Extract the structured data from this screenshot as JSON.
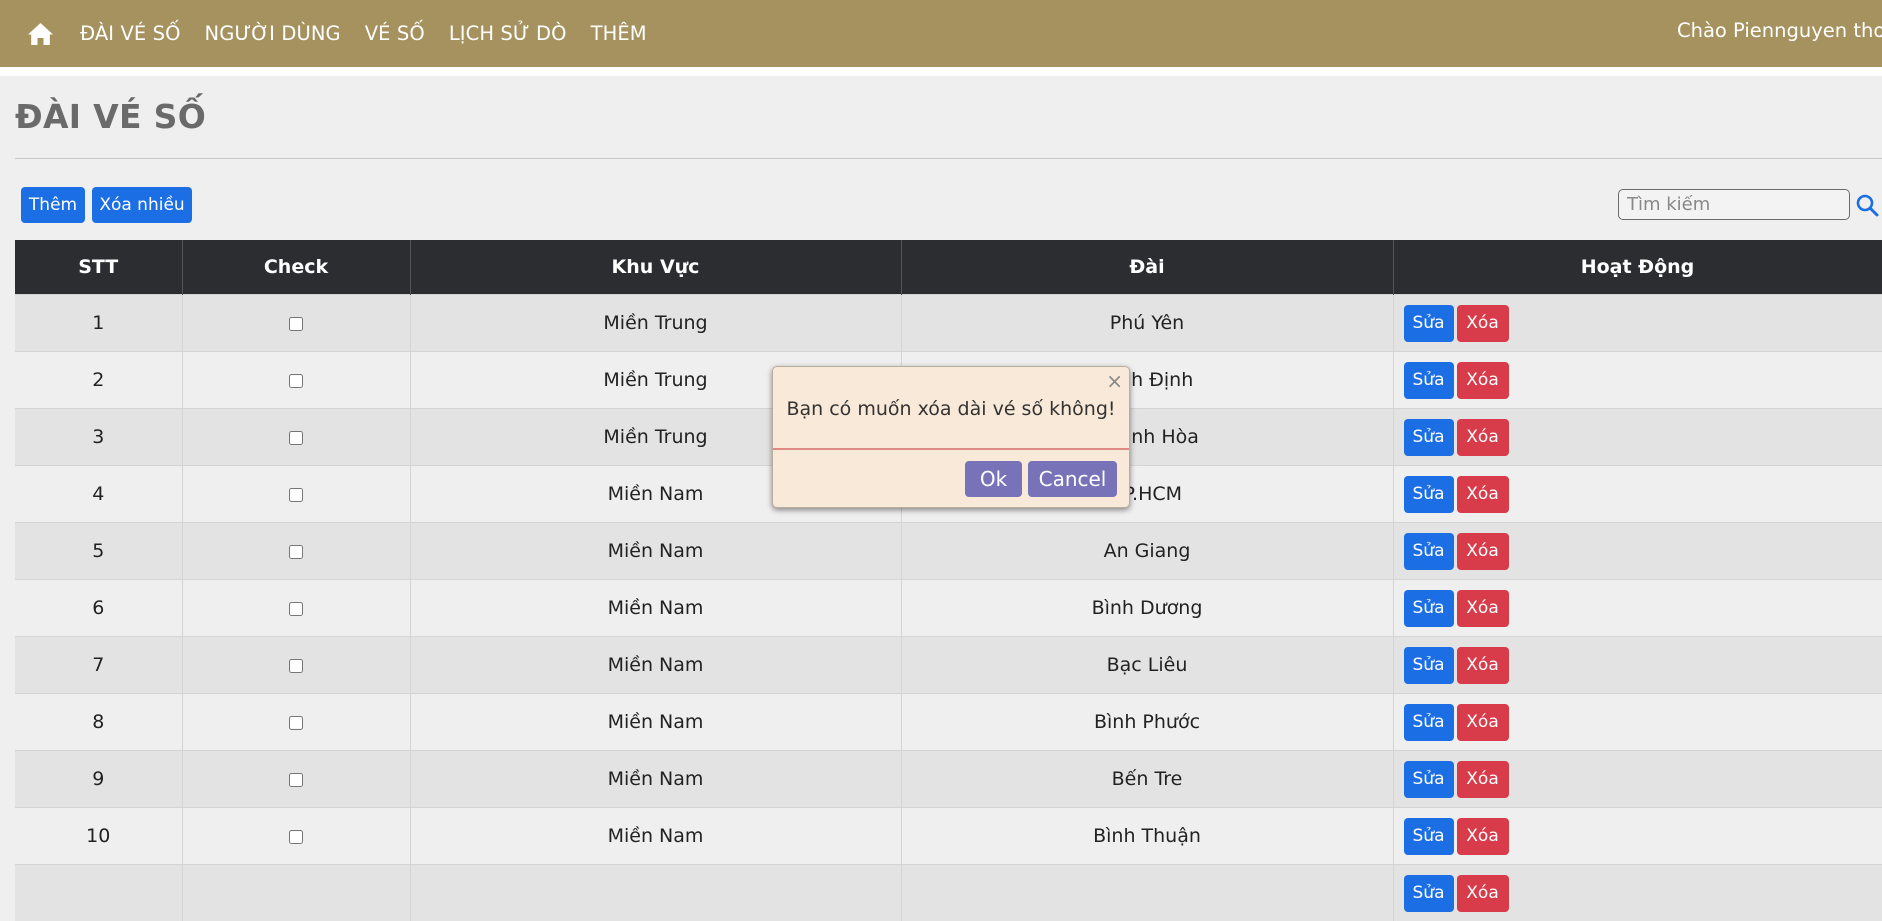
{
  "nav": {
    "items": [
      "ĐÀI VÉ SỐ",
      "NGƯỜI DÙNG",
      "VÉ SỐ",
      "LỊCH SỬ DÒ",
      "THÊM"
    ],
    "greeting": "Chào  Piennguyen  thoá"
  },
  "page": {
    "title": "ĐÀI VÉ SỐ"
  },
  "toolbar": {
    "add_label": "Thêm",
    "delete_many_label": "Xóa nhiều"
  },
  "search": {
    "placeholder": "Tìm kiếm",
    "value": ""
  },
  "table": {
    "headers": [
      "STT",
      "Check",
      "Khu Vực",
      "Đài",
      "Hoạt Động"
    ],
    "rows": [
      {
        "stt": "1",
        "region": "Miền Trung",
        "station": "Phú Yên"
      },
      {
        "stt": "2",
        "region": "Miền Trung",
        "station": "Bình Định"
      },
      {
        "stt": "3",
        "region": "Miền Trung",
        "station": "Khánh Hòa"
      },
      {
        "stt": "4",
        "region": "Miền Nam",
        "station": "TP.HCM"
      },
      {
        "stt": "5",
        "region": "Miền Nam",
        "station": "An Giang"
      },
      {
        "stt": "6",
        "region": "Miền Nam",
        "station": "Bình Dương"
      },
      {
        "stt": "7",
        "region": "Miền Nam",
        "station": "Bạc Liêu"
      },
      {
        "stt": "8",
        "region": "Miền Nam",
        "station": "Bình Phước"
      },
      {
        "stt": "9",
        "region": "Miền Nam",
        "station": "Bến Tre"
      },
      {
        "stt": "10",
        "region": "Miền Nam",
        "station": "Bình Thuận"
      },
      {
        "stt": "",
        "region": "",
        "station": ""
      }
    ],
    "edit_label": "Sửa",
    "delete_label": "Xóa"
  },
  "dialog": {
    "message": "Bạn có muốn xóa dài vé số không!",
    "ok_label": "Ok",
    "cancel_label": "Cancel",
    "close_glyph": "×"
  },
  "colors": {
    "navbar": "#a6925f",
    "primary": "#1c6ee5",
    "danger": "#d83b49",
    "dialog_bg": "#f9e9d8",
    "dialog_button": "#7873b8",
    "table_header": "#2b2d30"
  }
}
